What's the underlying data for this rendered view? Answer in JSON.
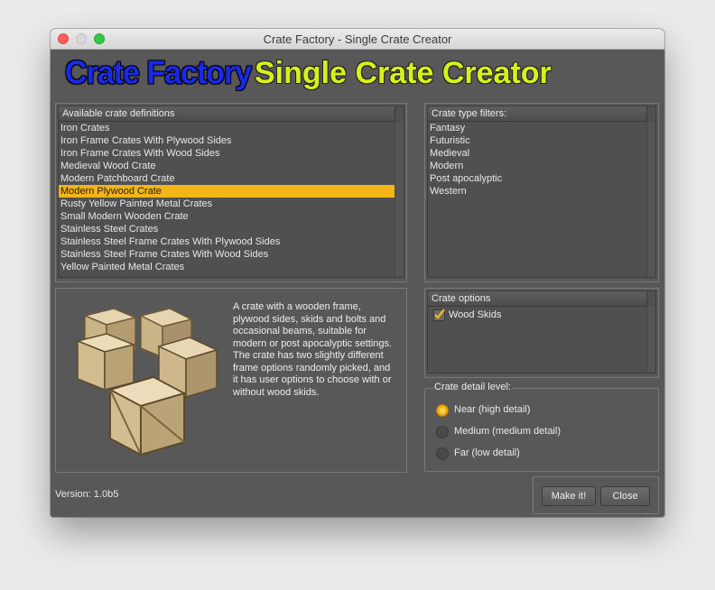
{
  "window": {
    "title": "Crate Factory - Single Crate Creator"
  },
  "header": {
    "logo_left": "Crate Factory",
    "logo_right": "Single Crate Creator"
  },
  "definitions": {
    "header": "Available crate definitions",
    "items": [
      "Iron Crates",
      "Iron Frame Crates With Plywood Sides",
      "Iron Frame Crates With Wood Sides",
      "Medieval Wood Crate",
      "Modern Patchboard Crate",
      "Modern Plywood Crate",
      "Rusty Yellow Painted Metal Crates",
      "Small Modern Wooden Crate",
      "Stainless Steel Crates",
      "Stainless Steel Frame Crates With Plywood Sides",
      "Stainless Steel Frame Crates With Wood Sides",
      "Yellow Painted Metal Crates"
    ],
    "selected": "Modern Plywood Crate"
  },
  "filters": {
    "header": "Crate type filters:",
    "items": [
      "Fantasy",
      "Futuristic",
      "Medieval",
      "Modern",
      "Post apocalyptic",
      "Western"
    ]
  },
  "preview": {
    "description": "A crate with a wooden frame, plywood sides, skids and bolts and occasional beams, suitable for modern or post apocalyptic settings. The crate has two slightly different frame options randomly picked, and it has user options to choose with or without wood skids."
  },
  "options": {
    "header": "Crate options",
    "wood_skids_label": "Wood Skids",
    "wood_skids_checked": true
  },
  "detail": {
    "label": "Crate detail level:",
    "near": "Near (high detail)",
    "medium": "Medium (medium detail)",
    "far": "Far (low detail)",
    "selected": "near"
  },
  "footer": {
    "version": "Version: 1.0b5"
  },
  "buttons": {
    "make": "Make it!",
    "close": "Close"
  },
  "colors": {
    "selection": "#f5b417",
    "logo_blue": "#1a28e8",
    "logo_yellow": "#d6f01a"
  }
}
